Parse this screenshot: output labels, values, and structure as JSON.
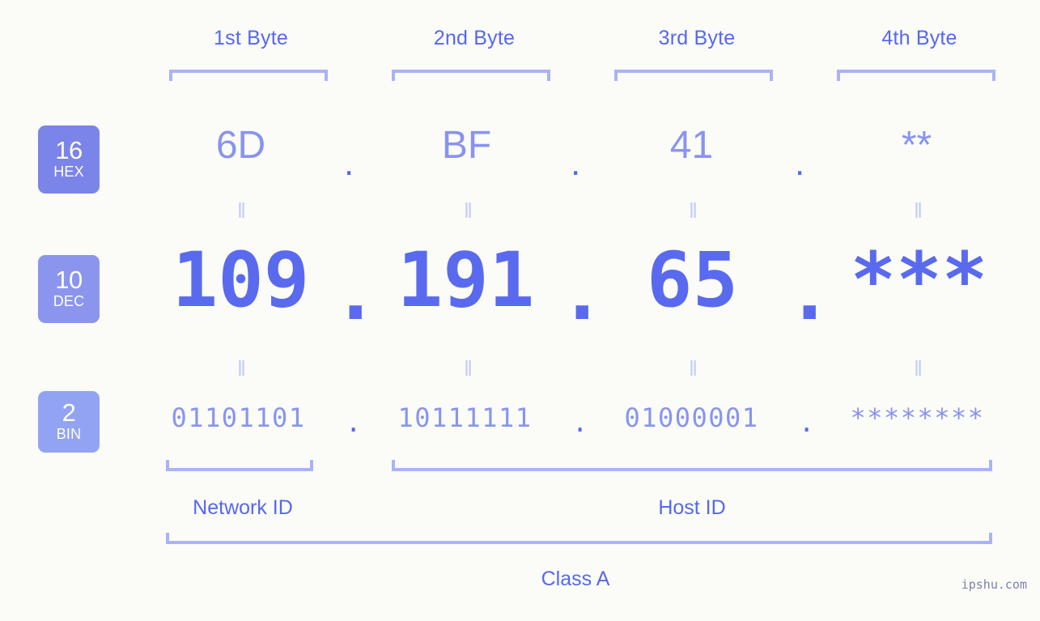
{
  "meta": {
    "watermark": "ipshu.com",
    "background_color": "#fbfcf8",
    "accent_color": "#5568f0",
    "light_accent_color": "#8894f0",
    "bracket_color": "#aab3f7",
    "eq_marker_color": "#c2caf9",
    "eq_marker": "‖"
  },
  "header": {
    "bytes": [
      {
        "label": "1st Byte"
      },
      {
        "label": "2nd Byte"
      },
      {
        "label": "3rd Byte"
      },
      {
        "label": "4th Byte"
      }
    ]
  },
  "rows": {
    "hex": {
      "badge_number": "16",
      "badge_label": "HEX",
      "badge_color": "#7b84e8",
      "separator": ".",
      "values": [
        "6D",
        "BF",
        "41",
        "**"
      ]
    },
    "dec": {
      "badge_number": "10",
      "badge_label": "DEC",
      "badge_color": "#8b95ee",
      "separator": ".",
      "values": [
        "109",
        "191",
        "65",
        "***"
      ]
    },
    "bin": {
      "badge_number": "2",
      "badge_label": "BIN",
      "badge_color": "#93a3f4",
      "separator": ".",
      "values": [
        "01101101",
        "10111111",
        "01000001",
        "********"
      ]
    }
  },
  "footer": {
    "network_id_label": "Network ID",
    "host_id_label": "Host ID",
    "class_label": "Class A"
  }
}
